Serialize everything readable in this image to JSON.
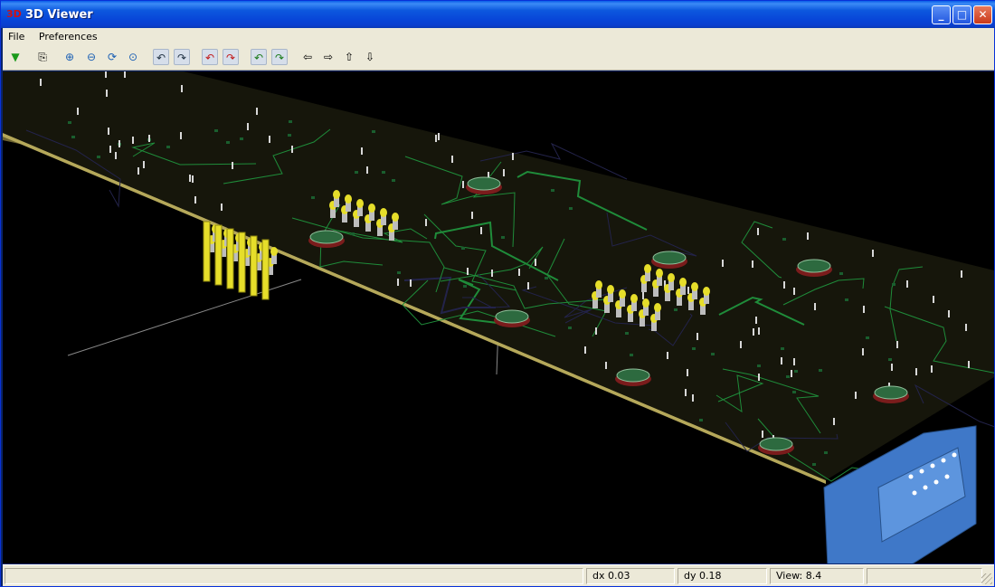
{
  "window": {
    "title": "3D Viewer",
    "app_icon": "3d-viewer-icon"
  },
  "menu": {
    "items": [
      "File",
      "Preferences"
    ]
  },
  "toolbar": {
    "icons": [
      "reload-board-icon",
      "copy-to-clipboard-icon",
      "zoom-in-icon",
      "zoom-out-icon",
      "zoom-redraw-icon",
      "zoom-fit-icon",
      "rotate-x-neg-icon",
      "rotate-x-pos-icon",
      "rotate-y-neg-icon",
      "rotate-y-pos-icon",
      "rotate-z-neg-icon",
      "rotate-z-pos-icon",
      "move-left-icon",
      "move-right-icon",
      "move-up-icon",
      "move-down-icon"
    ]
  },
  "status": {
    "main": "",
    "dx": "dx 0.03",
    "dy": "dy 0.18",
    "view": "View: 8.4"
  },
  "colors": {
    "board": "#16160b",
    "trace": "#1f8c3a",
    "pin": "#e6de2a",
    "connector": "#3f78c8",
    "viewport_bg": "#000000"
  }
}
